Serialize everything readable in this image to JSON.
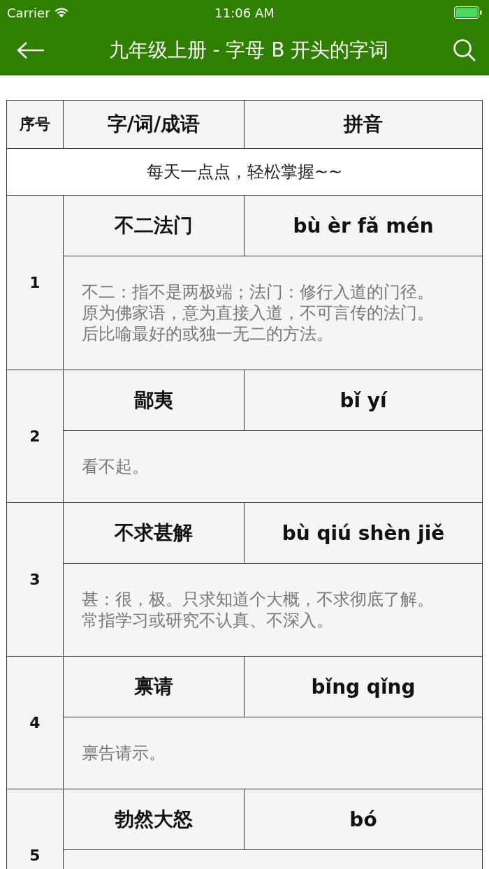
{
  "status_bar": {
    "carrier": "Carrier",
    "time": "11:06 AM"
  },
  "nav_bar": {
    "title": "九年级上册 - 字母 B 开头的字词"
  },
  "table": {
    "columns": [
      "序号",
      "字/词/成语",
      "拼音"
    ],
    "banner": "每天一点点，轻松掌握~~",
    "rows": [
      {
        "index": "1",
        "word": "不二法门",
        "pinyin": "bù èr fǎ mén",
        "definition": "不二：指不是两极端；法门：修行入道的门径。原为佛家语，意为直接入道，不可言传的法门。后比喻最好的或独一无二的方法。"
      },
      {
        "index": "2",
        "word": "鄙夷",
        "pinyin": "bǐ yí",
        "definition": "看不起。"
      },
      {
        "index": "3",
        "word": "不求甚解",
        "pinyin": "bù qiú shèn jiě",
        "definition": "甚：很，极。只求知道个大概，不求彻底了解。常指学习或研究不认真、不深入。"
      },
      {
        "index": "4",
        "word": "禀请",
        "pinyin": "bǐng qǐng",
        "definition": "禀告请示。"
      },
      {
        "index": "5",
        "word": "勃然大怒",
        "pinyin": "bó"
      }
    ]
  }
}
